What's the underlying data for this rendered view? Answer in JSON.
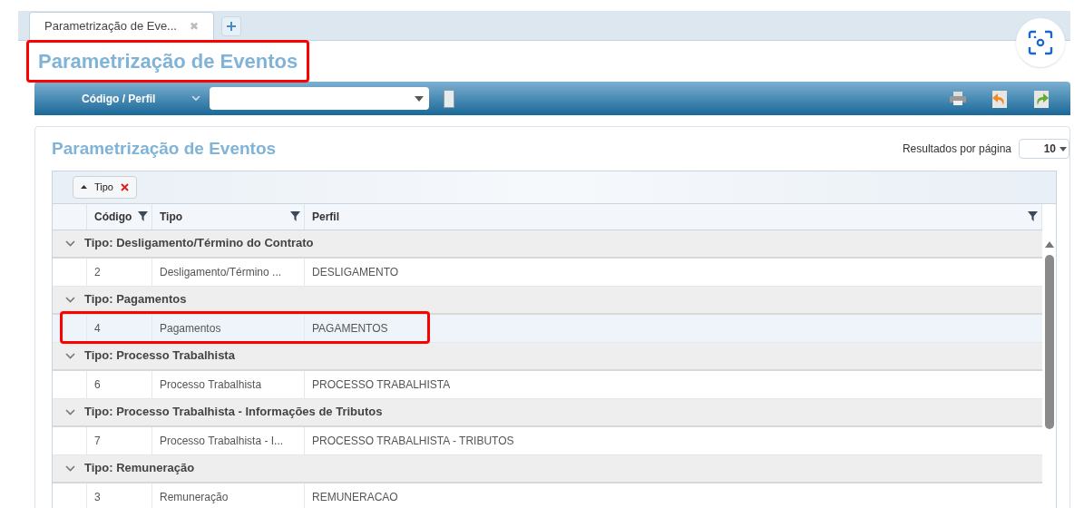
{
  "tabs": [
    {
      "label": "Parametrização de Eve...",
      "selected": true,
      "close": "✖"
    }
  ],
  "page_title": {
    "text": "Parametrização de Eventos",
    "highlighted": true
  },
  "toolbar": {
    "search_by": "Código / Perfil"
  },
  "panel": {
    "title": "Parametrização de Eventos",
    "results_per_page_label": "Resultados por página",
    "results_per_page": "10"
  },
  "grouping": {
    "label": "Tipo"
  },
  "table": {
    "columns": [
      "Código",
      "Tipo",
      "Perfil"
    ],
    "groups": [
      {
        "label": "Tipo: Desligamento/Término do Contrato",
        "expanded": true,
        "rows": [
          {
            "codigo": "2",
            "tipo": "Desligamento/Término ...",
            "perfil": "DESLIGAMENTO",
            "selected": false,
            "highlighted": false
          }
        ]
      },
      {
        "label": "Tipo: Pagamentos",
        "expanded": true,
        "rows": [
          {
            "codigo": "4",
            "tipo": "Pagamentos",
            "perfil": "PAGAMENTOS",
            "selected": true,
            "highlighted": true
          }
        ]
      },
      {
        "label": "Tipo: Processo Trabalhista",
        "expanded": true,
        "rows": [
          {
            "codigo": "6",
            "tipo": "Processo Trabalhista",
            "perfil": "PROCESSO TRABALHISTA",
            "selected": false,
            "highlighted": false
          }
        ]
      },
      {
        "label": "Tipo: Processo Trabalhista - Informações de Tributos",
        "expanded": true,
        "rows": [
          {
            "codigo": "7",
            "tipo": "Processo Trabalhista - I...",
            "perfil": "PROCESSO TRABALHISTA - TRIBUTOS",
            "selected": false,
            "highlighted": false
          }
        ]
      },
      {
        "label": "Tipo: Remuneração",
        "expanded": true,
        "rows": [
          {
            "codigo": "3",
            "tipo": "Remuneração",
            "perfil": "REMUNERACAO",
            "selected": false,
            "highlighted": false
          }
        ]
      }
    ]
  }
}
